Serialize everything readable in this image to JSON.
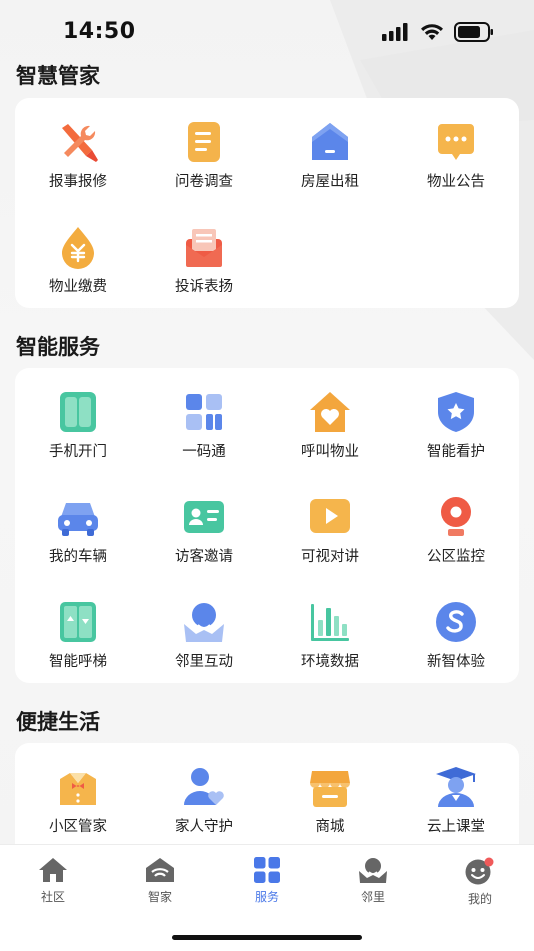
{
  "status_bar": {
    "time": "14:50"
  },
  "sections": [
    {
      "title": "智慧管家",
      "items": [
        {
          "label": "报事报修",
          "icon": "wrench-screwdriver-icon"
        },
        {
          "label": "问卷调查",
          "icon": "document-icon"
        },
        {
          "label": "房屋出租",
          "icon": "house-icon"
        },
        {
          "label": "物业公告",
          "icon": "message-icon"
        },
        {
          "label": "物业缴费",
          "icon": "yuan-drop-icon"
        },
        {
          "label": "投诉表扬",
          "icon": "envelope-icon"
        }
      ]
    },
    {
      "title": "智能服务",
      "items": [
        {
          "label": "手机开门",
          "icon": "door-icon"
        },
        {
          "label": "一码通",
          "icon": "grid-code-icon"
        },
        {
          "label": "呼叫物业",
          "icon": "house-heart-icon"
        },
        {
          "label": "智能看护",
          "icon": "shield-star-icon"
        },
        {
          "label": "我的车辆",
          "icon": "car-icon"
        },
        {
          "label": "访客邀请",
          "icon": "id-card-icon"
        },
        {
          "label": "可视对讲",
          "icon": "video-play-icon"
        },
        {
          "label": "公区监控",
          "icon": "camera-icon"
        },
        {
          "label": "智能呼梯",
          "icon": "elevator-icon"
        },
        {
          "label": "邻里互动",
          "icon": "neighbor-icon"
        },
        {
          "label": "环境数据",
          "icon": "bar-chart-icon"
        },
        {
          "label": "新智体验",
          "icon": "s-circle-icon"
        }
      ]
    },
    {
      "title": "便捷生活",
      "items": [
        {
          "label": "小区管家",
          "icon": "butler-icon"
        },
        {
          "label": "家人守护",
          "icon": "family-heart-icon"
        },
        {
          "label": "商城",
          "icon": "store-icon"
        },
        {
          "label": "云上课堂",
          "icon": "graduate-icon"
        }
      ]
    }
  ],
  "tabs": [
    {
      "label": "社区",
      "icon": "home-icon",
      "active": false
    },
    {
      "label": "智家",
      "icon": "smart-home-icon",
      "active": false
    },
    {
      "label": "服务",
      "icon": "apps-icon",
      "active": true
    },
    {
      "label": "邻里",
      "icon": "neighbor-tab-icon",
      "active": false
    },
    {
      "label": "我的",
      "icon": "profile-icon",
      "active": false
    }
  ],
  "colors": {
    "accent": "#4a78e8",
    "badge": "#f05a5a"
  }
}
